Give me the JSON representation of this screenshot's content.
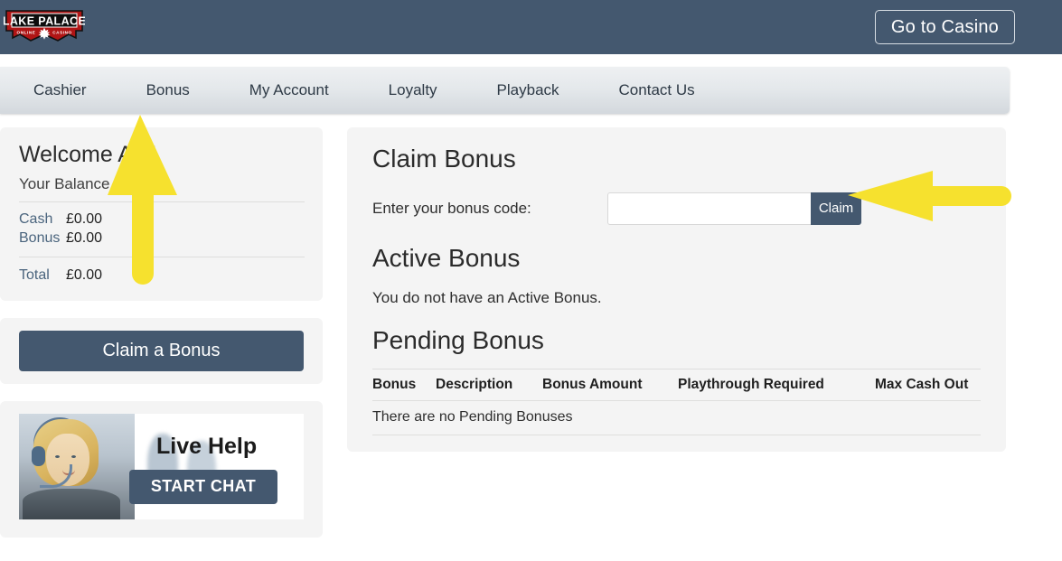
{
  "header": {
    "logo_primary": "LAKE PALACE",
    "logo_secondary_left": "ONLINE",
    "logo_secondary_right": "CASINO",
    "logo_icon": "maple-leaf-icon",
    "casino_button": "Go to Casino",
    "bar_color": "#44586f"
  },
  "nav": {
    "items": [
      {
        "label": "Cashier"
      },
      {
        "label": "Bonus"
      },
      {
        "label": "My Account"
      },
      {
        "label": "Loyalty"
      },
      {
        "label": "Playback"
      },
      {
        "label": "Contact Us"
      }
    ]
  },
  "sidebar": {
    "welcome": "Welcome A    n!",
    "balance_heading": "Your Balance",
    "rows": [
      {
        "label": "Cash",
        "value": "£0.00"
      },
      {
        "label": "Bonus",
        "value": "£0.00"
      },
      {
        "label": "Total",
        "value": "£0.00"
      }
    ],
    "claim_bonus_button": "Claim a Bonus",
    "live_help": {
      "title": "Live Help",
      "button": "START CHAT"
    }
  },
  "main": {
    "claim_bonus_heading": "Claim Bonus",
    "code_label": "Enter your bonus code:",
    "code_value": "",
    "code_placeholder": "",
    "claim_button": "Claim",
    "active_bonus_heading": "Active Bonus",
    "active_bonus_message": "You do not have an Active Bonus.",
    "pending_bonus_heading": "Pending Bonus",
    "pending_columns": [
      "Bonus",
      "Description",
      "Bonus Amount",
      "Playthrough Required",
      "Max Cash Out"
    ],
    "pending_empty_message": "There are no Pending Bonuses"
  },
  "annotations": {
    "arrow_color": "#f6e12e",
    "arrow_up_target": "Bonus nav item / balance panel",
    "arrow_left_target": "Claim button"
  },
  "colors": {
    "accent_dark": "#44586f",
    "panel_bg": "#f4f4f4",
    "page_bg": "#ffffff",
    "label_blue": "#4a647d",
    "highlight_yellow": "#f6e12e"
  }
}
